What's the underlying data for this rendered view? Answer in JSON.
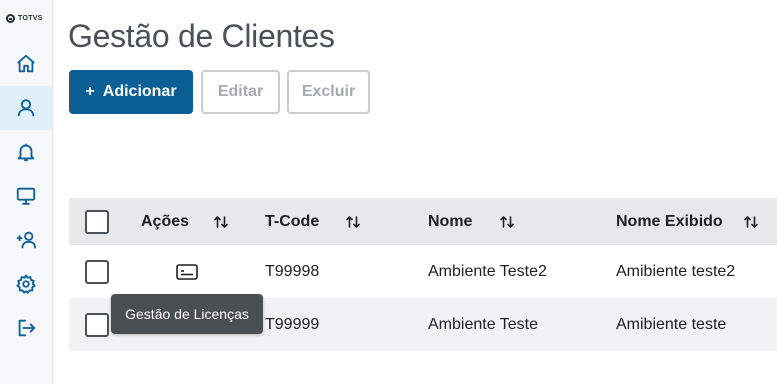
{
  "brand": {
    "logo_text": "TOTVS"
  },
  "sidebar": {
    "items": [
      {
        "icon": "home-icon",
        "label": ""
      },
      {
        "icon": "user-icon",
        "label": "",
        "active": true
      },
      {
        "icon": "bell-icon",
        "label": ""
      },
      {
        "icon": "monitor-icon",
        "label": ""
      },
      {
        "icon": "add-user-icon",
        "label": ""
      },
      {
        "icon": "gear-icon",
        "label": ""
      },
      {
        "icon": "logout-icon",
        "label": ""
      }
    ]
  },
  "page": {
    "title": "Gestão de Clientes"
  },
  "toolbar": {
    "add_icon": "+",
    "add_label": "Adicionar",
    "edit_label": "Editar",
    "delete_label": "Excluir"
  },
  "table": {
    "columns": [
      "Ações",
      "T-Code",
      "Nome",
      "Nome Exibido"
    ],
    "rows": [
      {
        "tcode": "T99998",
        "nome": "Ambiente Teste2",
        "nome_exibido": "Amibiente teste2"
      },
      {
        "tcode": "T99999",
        "nome": "Ambiente Teste",
        "nome_exibido": "Amibiente teste"
      }
    ]
  },
  "tooltip": {
    "text": "Gestão de Licenças"
  },
  "colors": {
    "primary": "#0c5f95",
    "active_bg": "#dff0fa",
    "header_bg": "#e6e8ea",
    "tooltip_bg": "#4a4f52"
  }
}
